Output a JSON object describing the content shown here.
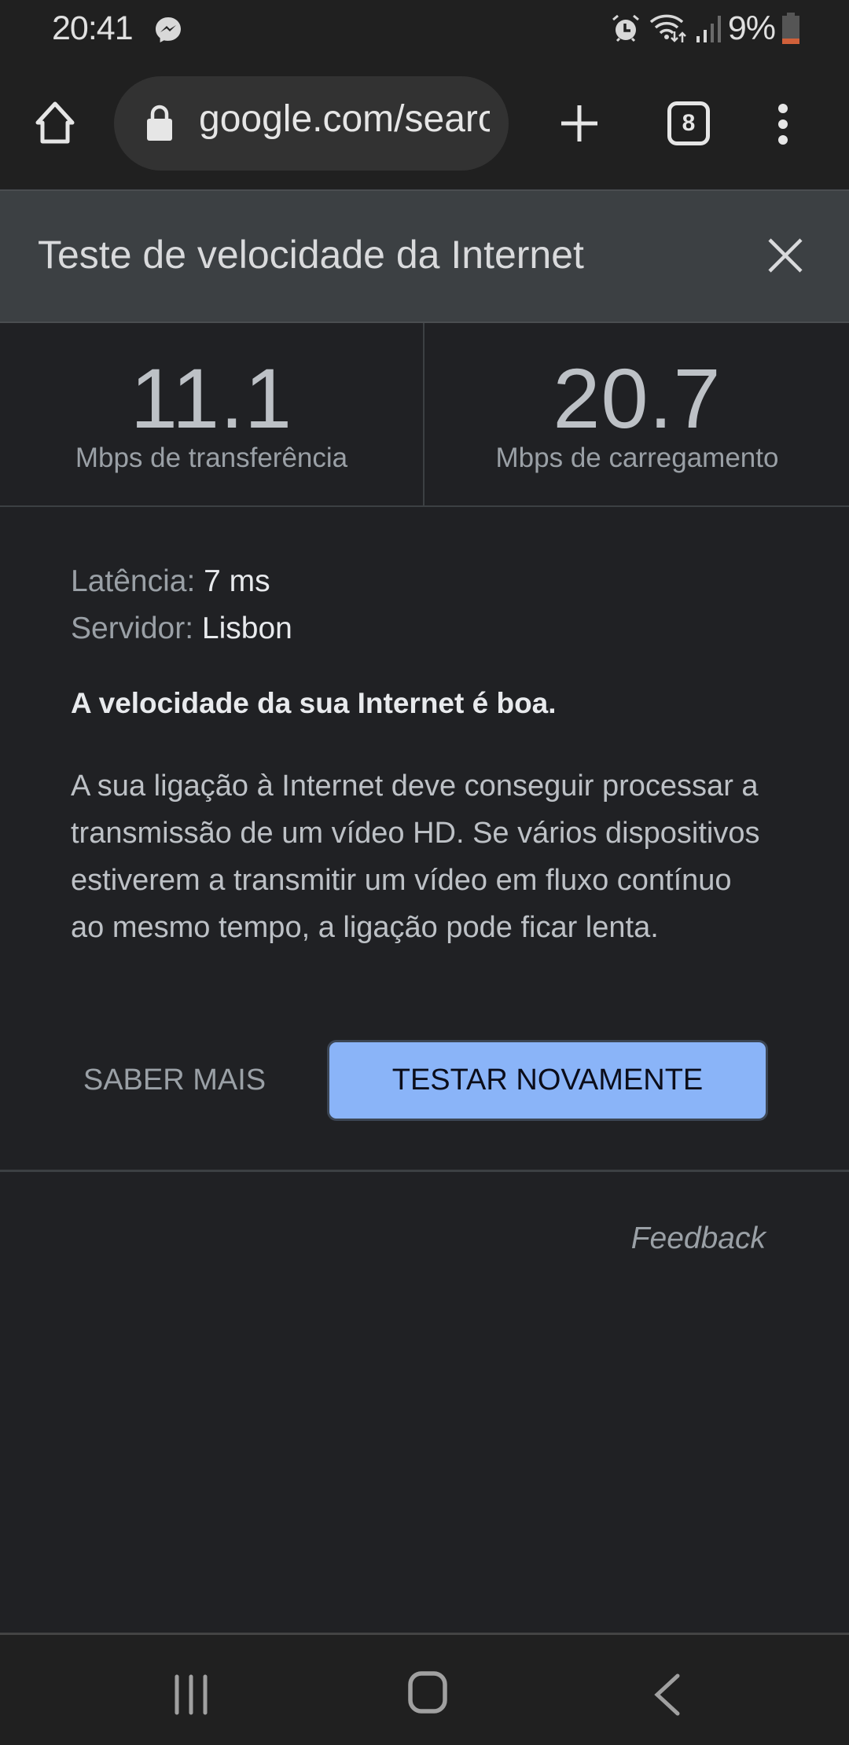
{
  "status_bar": {
    "time": "20:41",
    "battery_percent": "9%",
    "battery_level": 0.09,
    "notification_icons": [
      "messenger-icon"
    ],
    "system_icons": [
      "alarm-icon",
      "wifi-icon",
      "signal-icon",
      "battery-icon"
    ],
    "battery_low_color": "#d0603a"
  },
  "browser": {
    "url": "google.com/search",
    "tab_count": "8"
  },
  "speed_test": {
    "title": "Teste de velocidade da Internet",
    "download": {
      "value": "11.1",
      "label": "Mbps de transferência"
    },
    "upload": {
      "value": "20.7",
      "label": "Mbps de carregamento"
    },
    "latency": {
      "key": "Latência:",
      "value": "7 ms"
    },
    "server": {
      "key": "Servidor:",
      "value": "Lisbon"
    },
    "verdict": "A velocidade da sua Internet é boa.",
    "description": "A sua ligação à Internet deve conseguir processar a transmissão de um vídeo HD. Se vários dispositivos estiverem a transmitir um vídeo em fluxo contínuo ao mesmo tempo, a ligação pode ficar lenta.",
    "learn_more_label": "SABER MAIS",
    "retest_label": "TESTAR NOVAMENTE",
    "accent_color": "#8ab4f8"
  },
  "feedback_label": "Feedback"
}
